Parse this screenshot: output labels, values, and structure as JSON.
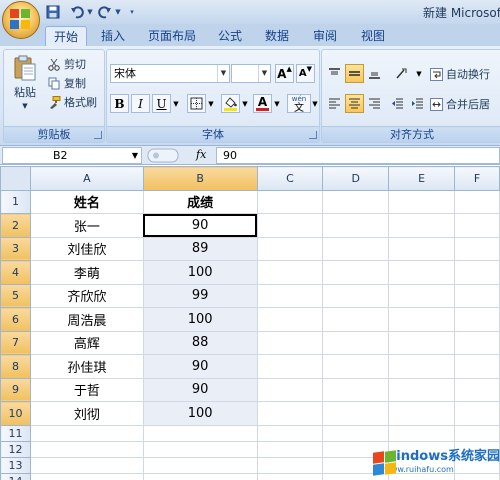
{
  "title_bar": {
    "window_title": "新建 Microsoft"
  },
  "quick_access": {
    "icons": [
      "save-icon",
      "undo-icon",
      "redo-icon",
      "customize-icon"
    ]
  },
  "tabs": [
    {
      "label": "开始",
      "active": true
    },
    {
      "label": "插入"
    },
    {
      "label": "页面布局"
    },
    {
      "label": "公式"
    },
    {
      "label": "数据"
    },
    {
      "label": "审阅"
    },
    {
      "label": "视图"
    }
  ],
  "ribbon": {
    "clipboard": {
      "label": "剪贴板",
      "paste": "粘贴",
      "cut": "剪切",
      "copy": "复制",
      "format_painter": "格式刷"
    },
    "font": {
      "label": "字体",
      "font_name": "宋体",
      "font_size": "",
      "grow_label": "A",
      "shrink_label": "A",
      "bold": "B",
      "italic": "I",
      "underline": "U",
      "font_color_letter": "A",
      "wen_label": "wén",
      "wen_char": "文",
      "fill_color": "#f7e30f",
      "font_color": "#d41f1f"
    },
    "alignment": {
      "label": "对齐方式",
      "wrap_text": "自动换行",
      "merge_center": "合并后居"
    }
  },
  "formula_bar": {
    "cell_ref": "B2",
    "fx": "fx",
    "formula": "90"
  },
  "grid": {
    "columns": [
      "A",
      "B",
      "C",
      "D",
      "E",
      "F"
    ],
    "selected_column": "B",
    "row_numbers": [
      "1",
      "2",
      "3",
      "4",
      "5",
      "6",
      "7",
      "8",
      "9",
      "10",
      "11",
      "12",
      "13",
      "14"
    ],
    "header": {
      "name": "姓名",
      "score": "成绩"
    },
    "rows": [
      {
        "name": "张一",
        "score": "90"
      },
      {
        "name": "刘佳欣",
        "score": "89"
      },
      {
        "name": "李萌",
        "score": "100"
      },
      {
        "name": "齐欣欣",
        "score": "99"
      },
      {
        "name": "周浩晨",
        "score": "100"
      },
      {
        "name": "高辉",
        "score": "88"
      },
      {
        "name": "孙佳琪",
        "score": "90"
      },
      {
        "name": "于哲",
        "score": "90"
      },
      {
        "name": "刘彻",
        "score": "100"
      }
    ]
  },
  "watermark": {
    "text": "windows系统家园",
    "url": "www.ruihafu.com"
  }
}
